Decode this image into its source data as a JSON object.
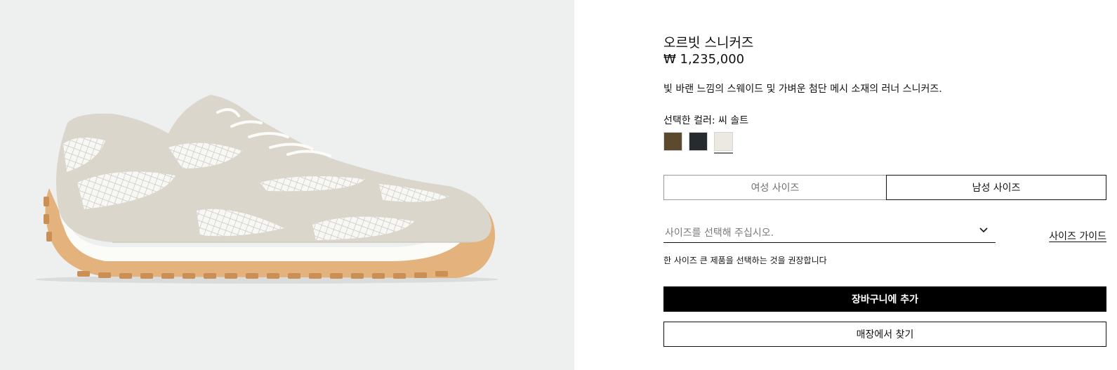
{
  "product": {
    "title": "오르빗 스니커즈",
    "price": "₩ 1,235,000",
    "description": "빛 바랜 느낌의 스웨이드 및 가벼운 첨단 메시 소재의 러너 스니커즈.",
    "image_alt": "오르빗 스니커즈"
  },
  "color": {
    "label": "선택한 컬러:",
    "selected": "씨 솔트",
    "swatches": [
      {
        "icon": "brown-swatch",
        "hex": "#5b4a2e"
      },
      {
        "icon": "navy-swatch",
        "hex": "#262b30"
      },
      {
        "icon": "sea-salt-swatch",
        "hex": "#ece9e2"
      }
    ],
    "selected_index": 2
  },
  "size_tabs": {
    "women": "여성 사이즈",
    "men": "남성 사이즈",
    "active": "men"
  },
  "size_select": {
    "placeholder": "사이즈를 선택해 주십시오."
  },
  "size_guide": "사이즈 가이드",
  "fit_note": "한 사이즈 큰 제품을 선택하는 것을 권장합니다",
  "buttons": {
    "add_to_cart": "장바구니에 추가",
    "find_in_store": "매장에서 찾기"
  }
}
